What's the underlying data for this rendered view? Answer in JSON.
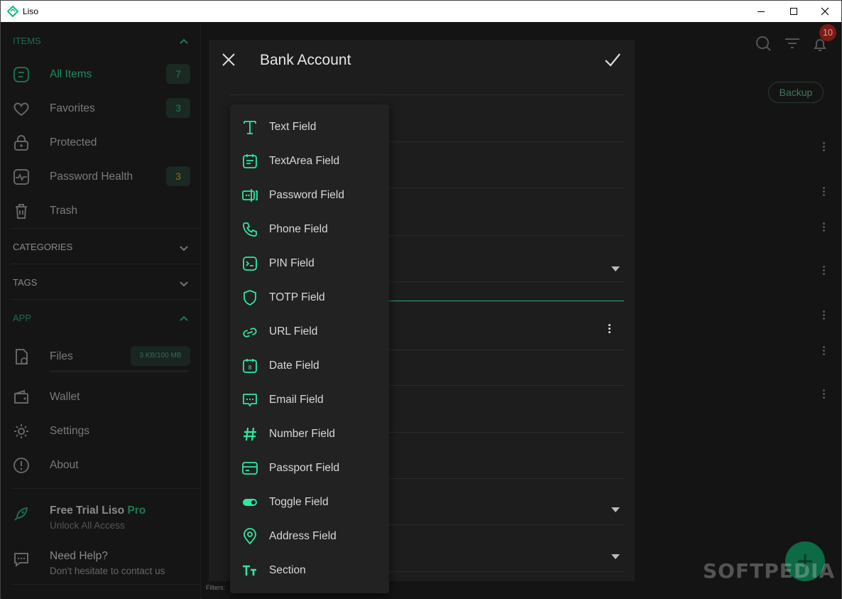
{
  "window": {
    "title": "Liso"
  },
  "sidebar": {
    "items_header": "ITEMS",
    "items": [
      {
        "label": "All Items",
        "count": "7"
      },
      {
        "label": "Favorites",
        "count": "3"
      },
      {
        "label": "Protected"
      },
      {
        "label": "Password Health",
        "count": "3"
      },
      {
        "label": "Trash"
      }
    ],
    "categories_header": "CATEGORIES",
    "tags_header": "TAGS",
    "app_header": "APP",
    "app_items": [
      {
        "label": "Files",
        "usage": "3 KB/100 MB"
      },
      {
        "label": "Wallet"
      },
      {
        "label": "Settings"
      },
      {
        "label": "About"
      }
    ],
    "trial": {
      "prefix": "Free Trial ",
      "brand": "Liso",
      "pro": " Pro",
      "subtitle": "Unlock All Access"
    },
    "help": {
      "title": "Need Help?",
      "subtitle": "Don't hesitate to contact us"
    }
  },
  "toolbar": {
    "notification_count": "10",
    "backup_label": "Backup",
    "filters_label": "Filters:"
  },
  "dialog": {
    "title": "Bank Account"
  },
  "field_menu": {
    "items": [
      {
        "label": "Text Field",
        "icon": "text-icon"
      },
      {
        "label": "TextArea Field",
        "icon": "textarea-icon"
      },
      {
        "label": "Password Field",
        "icon": "password-icon"
      },
      {
        "label": "Phone Field",
        "icon": "phone-icon"
      },
      {
        "label": "PIN Field",
        "icon": "pin-icon"
      },
      {
        "label": "TOTP Field",
        "icon": "shield-icon"
      },
      {
        "label": "URL Field",
        "icon": "link-icon"
      },
      {
        "label": "Date Field",
        "icon": "calendar-icon"
      },
      {
        "label": "Email Field",
        "icon": "chat-icon"
      },
      {
        "label": "Number Field",
        "icon": "hash-icon"
      },
      {
        "label": "Passport Field",
        "icon": "card-icon"
      },
      {
        "label": "Toggle Field",
        "icon": "toggle-icon"
      },
      {
        "label": "Address Field",
        "icon": "location-icon"
      },
      {
        "label": "Section",
        "icon": "section-icon"
      }
    ]
  },
  "watermark": "SOFTPEDIA",
  "colors": {
    "accent": "#2ee8a0",
    "accent_dim": "#1f8a5e",
    "badge_red": "#b42318"
  }
}
